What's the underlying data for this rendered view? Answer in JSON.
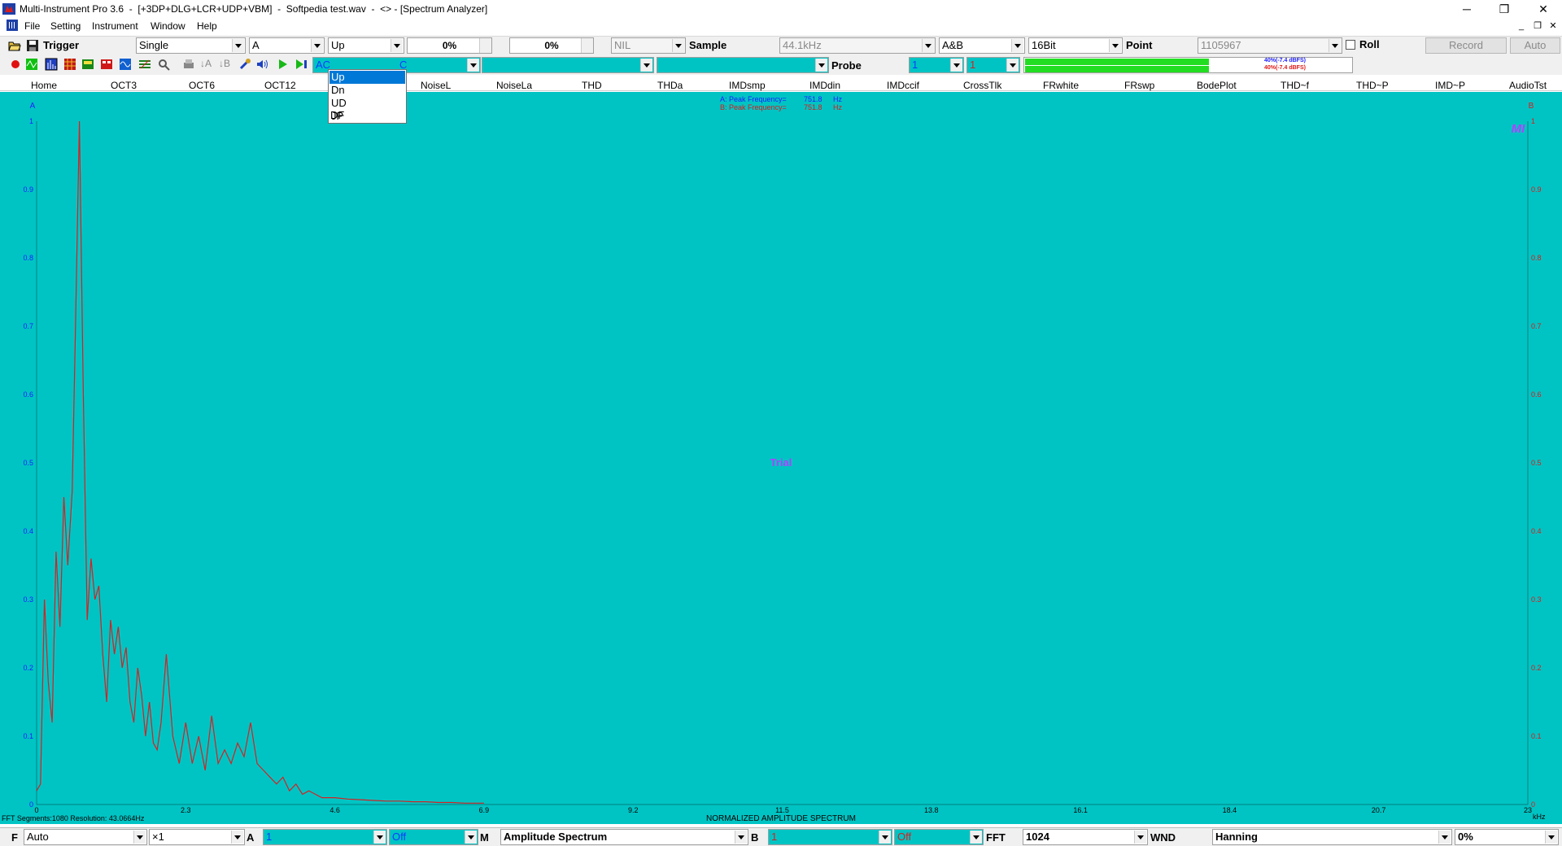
{
  "window": {
    "title": "Multi-Instrument Pro 3.6  -  [+3DP+DLG+LCR+UDP+VBM]  -  Softpedia test.wav  -  <> - [Spectrum Analyzer]",
    "min_glyph": "─",
    "max_glyph": "❐",
    "close_glyph": "✕"
  },
  "menu": {
    "items": [
      "File",
      "Setting",
      "Instrument",
      "Window",
      "Help"
    ],
    "mdi": {
      "min": "_",
      "restore": "❐",
      "close": "✕"
    }
  },
  "toolbar1": {
    "trigger_label": "Trigger",
    "trigger_mode": "Single",
    "trigger_channel": "A",
    "trigger_edge": "Up",
    "trigger_level": "0%",
    "trigger_delay": "0%",
    "nil_value": "NIL",
    "sample_label": "Sample",
    "sample_rate": "44.1kHz",
    "channels": "A&B",
    "bit_depth": "16Bit",
    "point_label": "Point",
    "point_value": "1105967",
    "roll_label": "Roll",
    "record_label": "Record",
    "auto_label": "Auto"
  },
  "toolbar2": {
    "coupling_a": "AC",
    "coupling_b": "C",
    "probe_label": "Probe",
    "probe_a": "1",
    "probe_b": "1",
    "meter_a_text": "40%(-7.4 dBFS)",
    "meter_b_text": "40%(-7.4 dBFS)",
    "meter_a_level": 0.56,
    "meter_b_level": 0.56
  },
  "tabs": [
    "Home",
    "OCT3",
    "OCT6",
    "OCT12",
    "NoiseL",
    "NoiseLa",
    "THD",
    "THDa",
    "IMDsmp",
    "IMDdin",
    "IMDccif",
    "CrossTlk",
    "FRwhite",
    "FRswp",
    "BodePlot",
    "THD~f",
    "THD~P",
    "IMD~P",
    "AudioTst"
  ],
  "dropdown": {
    "options": [
      "Up",
      "Dn",
      "UD",
      "JP",
      "DF"
    ],
    "selected": "Up"
  },
  "chart_data": {
    "type": "line",
    "title": "NORMALIZED AMPLITUDE SPECTRUM",
    "left_axis_label": "A",
    "right_axis_label": "B",
    "x_unit": "kHz",
    "x_ticks": [
      0,
      2.3,
      4.6,
      6.9,
      9.2,
      11.5,
      13.8,
      16.1,
      18.4,
      20.7,
      23
    ],
    "y_ticks": [
      0,
      0.1,
      0.2,
      0.3,
      0.4,
      0.5,
      0.6,
      0.7,
      0.8,
      0.9,
      1
    ],
    "xlim": [
      0,
      23
    ],
    "ylim": [
      0,
      1
    ],
    "peak_a_label": "A: Peak Frequency=",
    "peak_a_value": "751.8",
    "peak_b_label": "B: Peak Frequency=",
    "peak_b_value": "751.8",
    "peak_unit": "Hz",
    "watermark": "Trial",
    "logo_text": "MI",
    "footer_left": "FFT  Segments:1080    Resolution: 43.0664Hz",
    "series": [
      {
        "color": "#d42222",
        "x": [
          0,
          0.06,
          0.12,
          0.18,
          0.24,
          0.3,
          0.36,
          0.42,
          0.48,
          0.55,
          0.6,
          0.66,
          0.72,
          0.78,
          0.84,
          0.9,
          0.96,
          1.02,
          1.08,
          1.14,
          1.2,
          1.26,
          1.32,
          1.38,
          1.44,
          1.5,
          1.56,
          1.62,
          1.68,
          1.74,
          1.8,
          1.86,
          1.92,
          2.0,
          2.1,
          2.2,
          2.3,
          2.4,
          2.5,
          2.6,
          2.7,
          2.8,
          2.9,
          3.0,
          3.1,
          3.2,
          3.3,
          3.4,
          3.5,
          3.6,
          3.7,
          3.8,
          3.9,
          4.0,
          4.1,
          4.2,
          4.4,
          4.6,
          4.8,
          5.0,
          5.2,
          5.4,
          5.6,
          5.8,
          6.0,
          6.2,
          6.4,
          6.6,
          6.8,
          6.9
        ],
        "y": [
          0.02,
          0.03,
          0.3,
          0.18,
          0.12,
          0.37,
          0.26,
          0.45,
          0.35,
          0.46,
          0.7,
          1.0,
          0.6,
          0.27,
          0.36,
          0.3,
          0.32,
          0.22,
          0.15,
          0.27,
          0.22,
          0.26,
          0.2,
          0.23,
          0.15,
          0.12,
          0.2,
          0.16,
          0.1,
          0.15,
          0.09,
          0.08,
          0.12,
          0.22,
          0.1,
          0.06,
          0.12,
          0.06,
          0.1,
          0.05,
          0.13,
          0.06,
          0.08,
          0.06,
          0.09,
          0.07,
          0.12,
          0.06,
          0.05,
          0.04,
          0.03,
          0.04,
          0.02,
          0.03,
          0.015,
          0.02,
          0.01,
          0.01,
          0.008,
          0.007,
          0.006,
          0.005,
          0.005,
          0.004,
          0.004,
          0.003,
          0.003,
          0.002,
          0.002,
          0.002
        ]
      }
    ]
  },
  "bottom": {
    "f_label": "F",
    "f_mode": "Auto",
    "f_scale": "×1",
    "a_label": "A",
    "a_value": "1",
    "a_state": "Off",
    "m_label": "M",
    "m_mode": "Amplitude Spectrum",
    "b_label": "B",
    "b_value": "1",
    "b_state": "Off",
    "fft_label": "FFT",
    "fft_size": "1024",
    "wnd_label": "WND",
    "wnd_type": "Hanning",
    "overlap": "0%"
  }
}
